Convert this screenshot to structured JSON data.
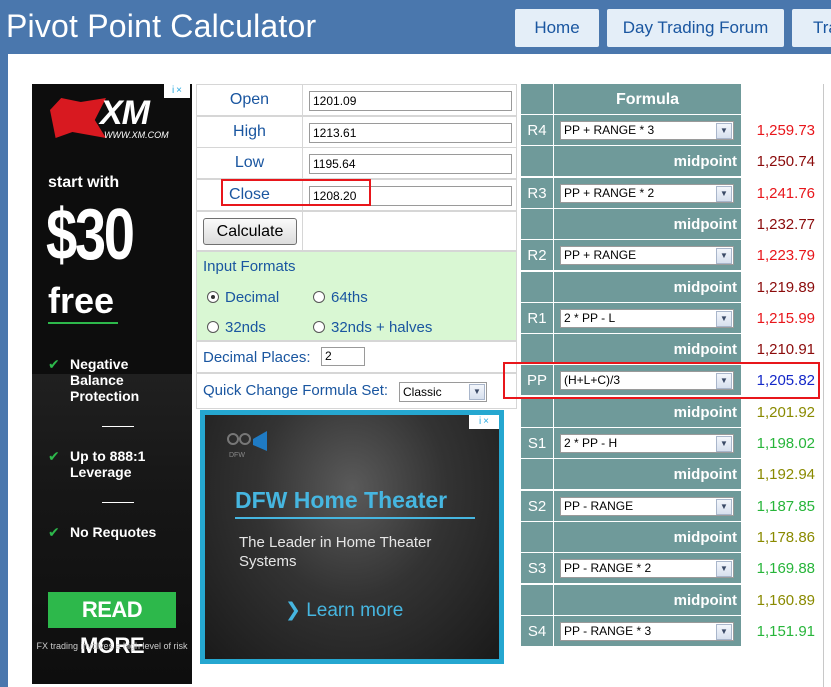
{
  "header": {
    "title": "Pivot Point Calculator",
    "nav": [
      {
        "label": "Home"
      },
      {
        "label": "Day Trading Forum"
      },
      {
        "label": "Tra"
      }
    ]
  },
  "xm_ad": {
    "adchoices": "i ×",
    "logo_text": "XM",
    "logo_url": "WWW.XM.COM",
    "start_with": "start with",
    "amount": "$30",
    "free": "free",
    "bullets": [
      "Negative Balance Protection",
      "Up to 888:1 Leverage",
      "No Requotes"
    ],
    "cta": "READ MORE",
    "risk": "FX trading involves a high level of risk",
    "colors": {
      "accent": "#2db84b",
      "logo": "#d81920"
    }
  },
  "form": {
    "fields": [
      {
        "label": "Open",
        "value": "1201.09"
      },
      {
        "label": "High",
        "value": "1213.61"
      },
      {
        "label": "Low",
        "value": "1195.64"
      },
      {
        "label": "Close",
        "value": "1208.20"
      }
    ],
    "calculate_label": "Calculate",
    "input_formats_title": "Input Formats",
    "formats": [
      {
        "label": "Decimal",
        "selected": true
      },
      {
        "label": "64ths",
        "selected": false
      },
      {
        "label": "32nds",
        "selected": false
      },
      {
        "label": "32nds + halves",
        "selected": false
      }
    ],
    "decimal_places_label": "Decimal Places:",
    "decimal_places_value": "2",
    "quick_change_label": "Quick Change Formula Set:",
    "quick_change_value": "Classic"
  },
  "ht_ad": {
    "adchoices": "i ×",
    "logo": "DFW",
    "title": "DFW Home Theater",
    "subtitle": "The Leader in Home Theater Systems",
    "learn_more": "Learn more"
  },
  "pivot": {
    "header": "Formula",
    "midpoint_label": "midpoint",
    "rows": [
      {
        "kind": "level",
        "label": "R4",
        "formula": "PP + RANGE * 3",
        "value": "1,259.73",
        "color": "#e8161b"
      },
      {
        "kind": "mid",
        "value": "1,250.74",
        "color": "#8b0b0b"
      },
      {
        "kind": "level",
        "label": "R3",
        "formula": "PP + RANGE * 2",
        "value": "1,241.76",
        "color": "#e8161b"
      },
      {
        "kind": "mid",
        "value": "1,232.77",
        "color": "#8b0b0b"
      },
      {
        "kind": "level",
        "label": "R2",
        "formula": "PP + RANGE",
        "value": "1,223.79",
        "color": "#e8161b"
      },
      {
        "kind": "mid",
        "value": "1,219.89",
        "color": "#8b0b0b"
      },
      {
        "kind": "level",
        "label": "R1",
        "formula": "2 * PP - L",
        "value": "1,215.99",
        "color": "#e8161b"
      },
      {
        "kind": "mid",
        "value": "1,210.91",
        "color": "#8b0b0b"
      },
      {
        "kind": "level",
        "label": "PP",
        "formula": "(H+L+C)/3",
        "value": "1,205.82",
        "color": "#1428c8"
      },
      {
        "kind": "mid",
        "value": "1,201.92",
        "color": "#8a8a00"
      },
      {
        "kind": "level",
        "label": "S1",
        "formula": "2 * PP - H",
        "value": "1,198.02",
        "color": "#27b53a"
      },
      {
        "kind": "mid",
        "value": "1,192.94",
        "color": "#8a8a00"
      },
      {
        "kind": "level",
        "label": "S2",
        "formula": "PP - RANGE",
        "value": "1,187.85",
        "color": "#27b53a"
      },
      {
        "kind": "mid",
        "value": "1,178.86",
        "color": "#8a8a00"
      },
      {
        "kind": "level",
        "label": "S3",
        "formula": "PP - RANGE * 2",
        "value": "1,169.88",
        "color": "#27b53a"
      },
      {
        "kind": "mid",
        "value": "1,160.89",
        "color": "#8a8a00"
      },
      {
        "kind": "level",
        "label": "S4",
        "formula": "PP - RANGE * 3",
        "value": "1,151.91",
        "color": "#27b53a"
      }
    ]
  }
}
